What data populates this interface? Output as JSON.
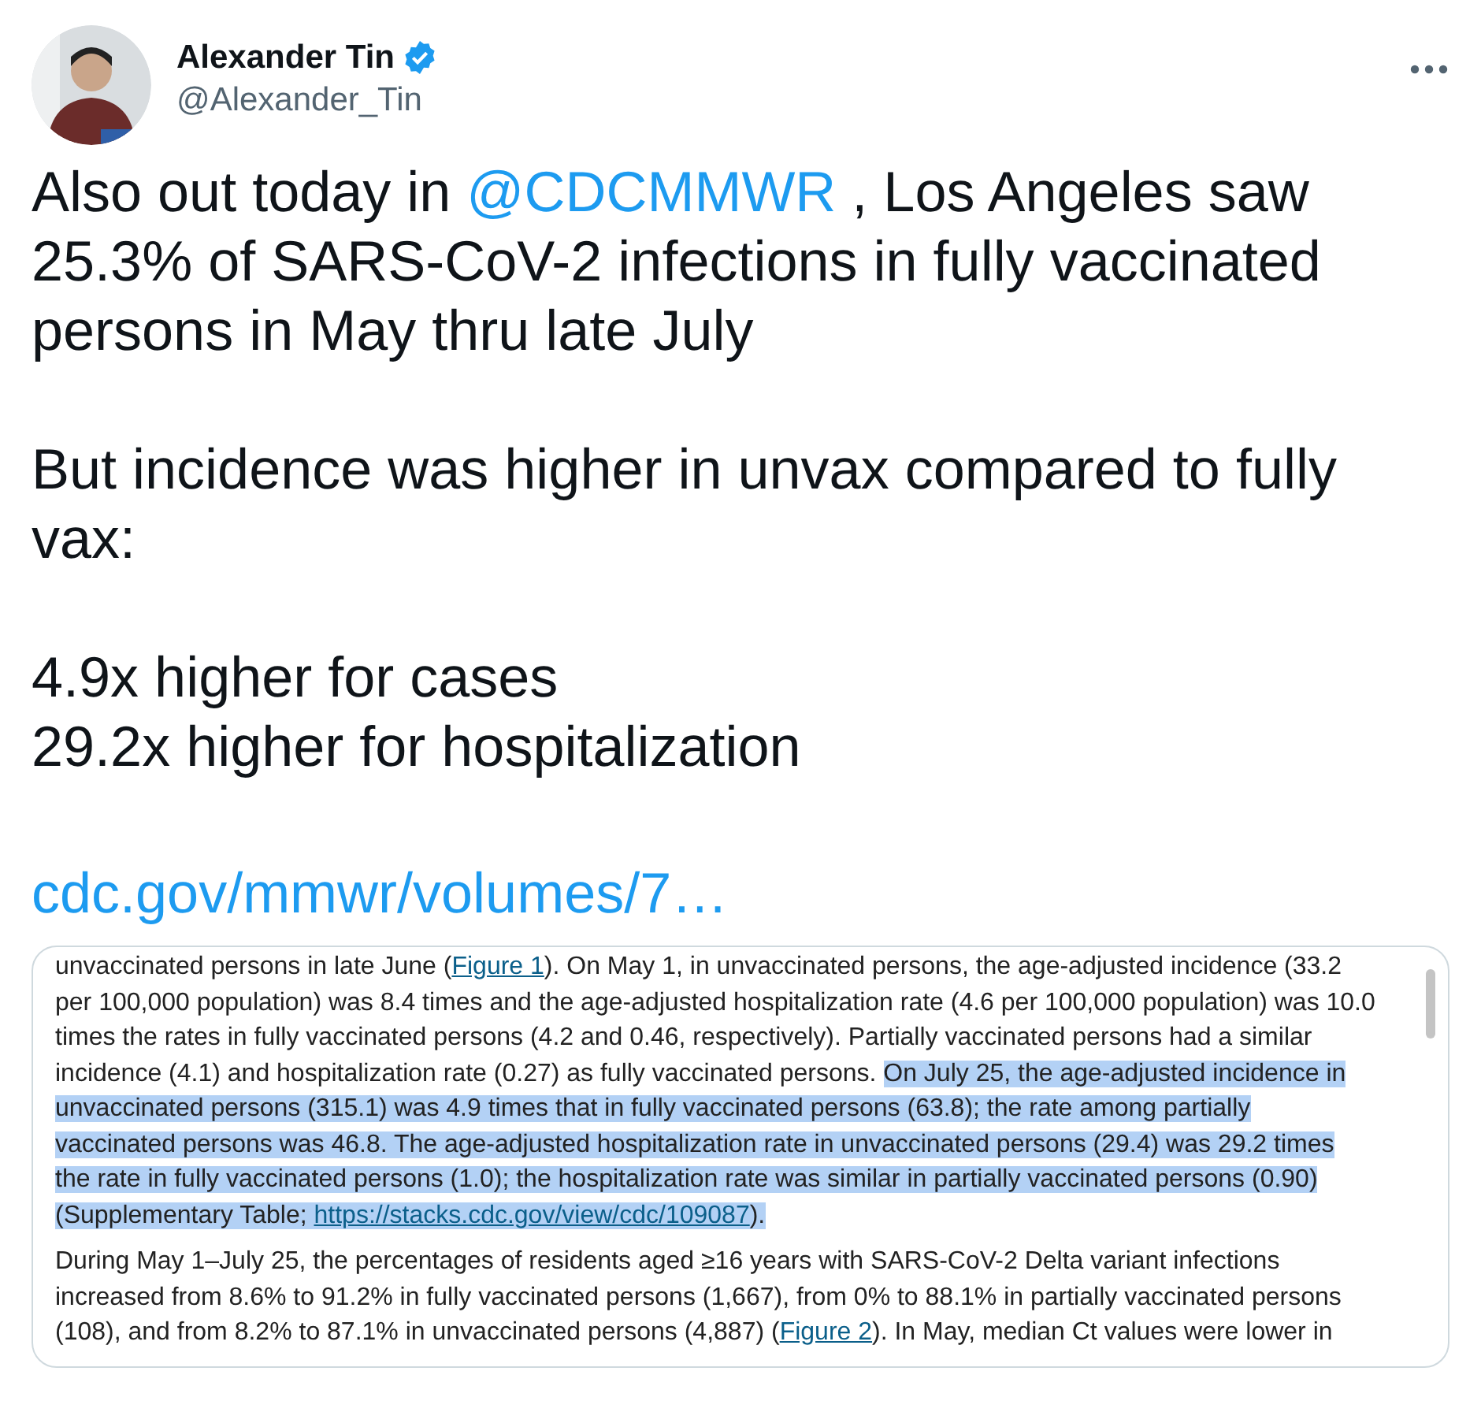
{
  "author": {
    "name": "Alexander Tin",
    "verified": true,
    "handle": "@Alexander_Tin"
  },
  "tweet": {
    "paragraphs": [
      {
        "lines": [
          [
            {
              "kind": "text",
              "text": "Also out today in "
            },
            {
              "kind": "mention",
              "text": "@CDCMMWR"
            },
            {
              "kind": "text",
              "text": " , Los Angeles saw 25.3% of SARS-CoV-2 infections in fully vaccinated persons in May thru late July"
            }
          ]
        ]
      },
      {
        "lines": [
          [
            {
              "kind": "text",
              "text": "But incidence was higher in unvax compared to fully vax:"
            }
          ]
        ]
      },
      {
        "lines": [
          [
            {
              "kind": "text",
              "text": "4.9x higher for cases"
            }
          ],
          [
            {
              "kind": "text",
              "text": "29.2x higher for hospitalization"
            }
          ]
        ]
      },
      {
        "lines": [
          [
            {
              "kind": "link",
              "text": "cdc.gov/mmwr/volumes/7…"
            }
          ]
        ]
      }
    ]
  },
  "document": {
    "paragraphs": [
      {
        "segments": [
          {
            "kind": "text",
            "highlighted": false,
            "text": "unvaccinated persons in late June ("
          },
          {
            "kind": "link",
            "highlighted": false,
            "text": "Figure 1"
          },
          {
            "kind": "text",
            "highlighted": false,
            "text": "). On May 1, in unvaccinated persons, the age-adjusted incidence (33.2 per 100,000 population) was 8.4 times and the age-adjusted hospitalization rate (4.6 per 100,000 population) was 10.0 times the rates in fully vaccinated persons (4.2 and 0.46, respectively). Partially vaccinated persons had a similar incidence (4.1) and hospitalization rate (0.27) as fully vaccinated persons. "
          },
          {
            "kind": "text",
            "highlighted": true,
            "text": "On July 25, the age-adjusted incidence in unvaccinated persons (315.1) was 4.9 times that in fully vaccinated persons (63.8); the rate among partially vaccinated persons was 46.8. The age-adjusted hospitalization rate in unvaccinated persons (29.4) was 29.2 times the rate in fully vaccinated persons (1.0); the hospitalization rate was similar in partially vaccinated persons (0.90) (Supplementary Table; "
          },
          {
            "kind": "link",
            "highlighted": true,
            "text": "https://stacks.cdc.gov/view/cdc/109087"
          },
          {
            "kind": "text",
            "highlighted": true,
            "text": ")."
          }
        ]
      },
      {
        "segments": [
          {
            "kind": "text",
            "highlighted": false,
            "text": "During May 1–July 25, the percentages of residents aged ≥16 years with SARS-CoV-2 Delta variant infections increased from 8.6% to 91.2% in fully vaccinated persons (1,667), from 0% to 88.1% in partially vaccinated persons (108), and from 8.2% to 87.1% in unvaccinated persons (4,887) ("
          },
          {
            "kind": "link",
            "highlighted": false,
            "text": "Figure 2"
          },
          {
            "kind": "text",
            "highlighted": false,
            "text": "). In May, median Ct values were lower in"
          }
        ]
      }
    ]
  }
}
